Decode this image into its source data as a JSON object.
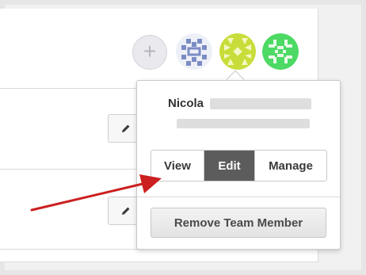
{
  "header": {
    "add_member_glyph": "+",
    "avatars": [
      {
        "icon": "identicon-blue-avatar",
        "color": "#7b8cc4"
      },
      {
        "icon": "identicon-yellow-avatar",
        "color": "#c9dd3a"
      },
      {
        "icon": "identicon-green-avatar",
        "color": "#4cd964"
      }
    ]
  },
  "popover": {
    "member_name": "Nicola",
    "roles": {
      "view_label": "View",
      "edit_label": "Edit",
      "manage_label": "Manage",
      "selected": "Edit"
    },
    "remove_label": "Remove Team Member"
  },
  "colors": {
    "selected_role_bg": "#5c5c5c",
    "annotation_arrow": "#cc1f1f"
  }
}
